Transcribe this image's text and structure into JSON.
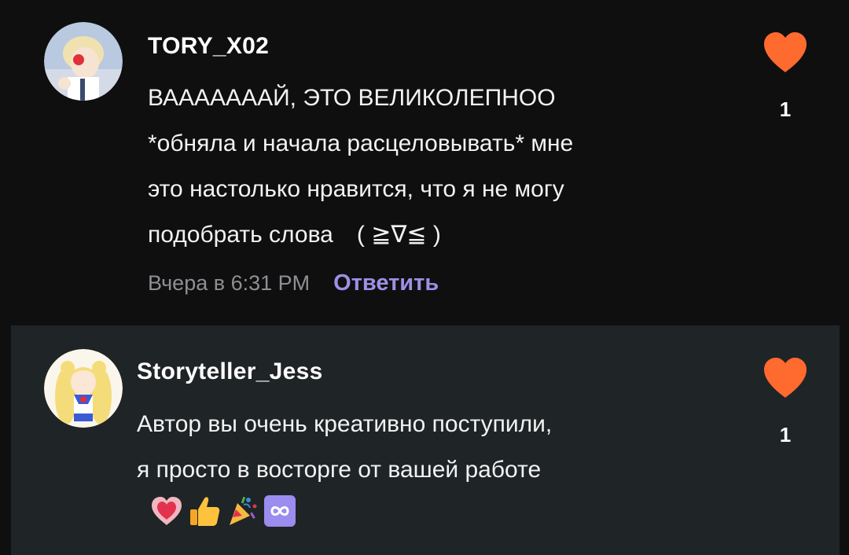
{
  "comments": [
    {
      "username": "TORY_X02",
      "lines": [
        "ВАААААААЙ, ЭТО ВЕЛИКОЛЕПНОО",
        "*обняла и начала расцеловывать* мне",
        "это настолько нравится, что я не могу",
        "подобрать слова　( ≧∇≦ )"
      ],
      "timestamp": "Вчера в 6:31 PM",
      "reply_label": "Ответить",
      "like_count": "1"
    },
    {
      "username": "Storyteller_Jess",
      "lines": [
        "Автор вы очень креативно поступили,",
        "я просто в восторге от вашей работе"
      ],
      "emojis": [
        "heart-emoji",
        "thumbs-up-emoji",
        "sparkles-emoji",
        "infinity-emoji"
      ],
      "like_count": "1"
    }
  ],
  "colors": {
    "background": "#0f0f10",
    "highlighted_background": "#1f2426",
    "like_heart": "#ff6a2f",
    "reply_link": "#9c90e6",
    "timestamp": "#8f8f94"
  }
}
